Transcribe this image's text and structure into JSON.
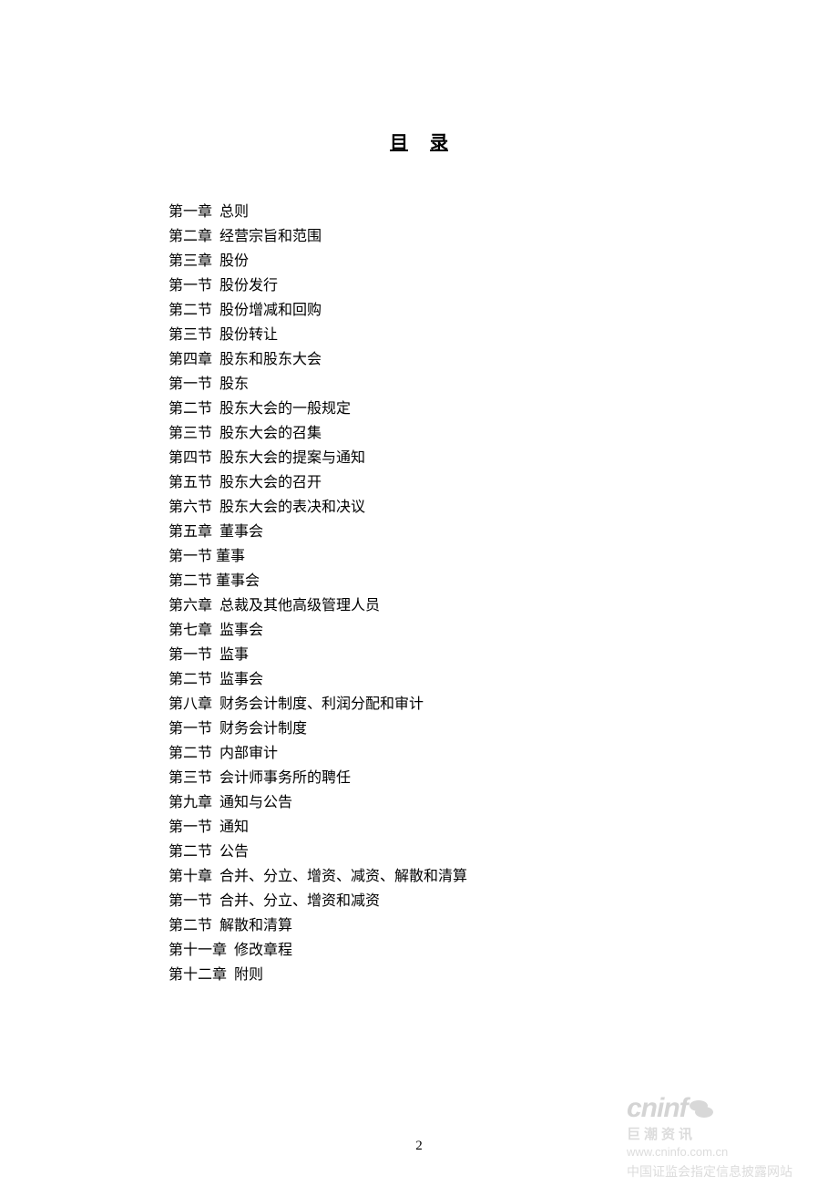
{
  "title_char1": "目",
  "title_char2": "录",
  "page_number": "2",
  "toc": [
    {
      "label": "第一章",
      "text": "总则"
    },
    {
      "label": "第二章",
      "text": "经营宗旨和范围"
    },
    {
      "label": "第三章",
      "text": "股份"
    },
    {
      "label": "第一节",
      "text": "股份发行"
    },
    {
      "label": "第二节",
      "text": "股份增减和回购"
    },
    {
      "label": "第三节",
      "text": "股份转让"
    },
    {
      "label": "第四章",
      "text": "股东和股东大会"
    },
    {
      "label": "第一节",
      "text": "股东"
    },
    {
      "label": "第二节",
      "text": "股东大会的一般规定"
    },
    {
      "label": "第三节",
      "text": "股东大会的召集"
    },
    {
      "label": "第四节",
      "text": "股东大会的提案与通知"
    },
    {
      "label": "第五节",
      "text": "股东大会的召开"
    },
    {
      "label": "第六节",
      "text": "股东大会的表决和决议"
    },
    {
      "label": "第五章",
      "text": "董事会"
    },
    {
      "label": "第一节",
      "text": "董事",
      "tight": true
    },
    {
      "label": "第二节",
      "text": "董事会",
      "tight": true
    },
    {
      "label": "第六章",
      "text": "总裁及其他高级管理人员"
    },
    {
      "label": "第七章",
      "text": "监事会"
    },
    {
      "label": "第一节",
      "text": "监事"
    },
    {
      "label": "第二节",
      "text": "监事会"
    },
    {
      "label": "第八章",
      "text": "财务会计制度、利润分配和审计"
    },
    {
      "label": "第一节",
      "text": "财务会计制度"
    },
    {
      "label": "第二节",
      "text": "内部审计"
    },
    {
      "label": "第三节",
      "text": "会计师事务所的聘任"
    },
    {
      "label": "第九章",
      "text": "通知与公告"
    },
    {
      "label": "第一节",
      "text": "通知"
    },
    {
      "label": "第二节",
      "text": "公告"
    },
    {
      "label": "第十章",
      "text": "合并、分立、增资、减资、解散和清算"
    },
    {
      "label": "第一节",
      "text": "合并、分立、增资和减资"
    },
    {
      "label": "第二节",
      "text": "解散和清算"
    },
    {
      "label": "第十一章",
      "text": "修改章程"
    },
    {
      "label": "第十二章",
      "text": "附则"
    }
  ],
  "watermark": {
    "brand": "cninf",
    "sub": "巨潮资讯",
    "url": "www.cninfo.com.cn",
    "desc": "中国证监会指定信息披露网站"
  }
}
